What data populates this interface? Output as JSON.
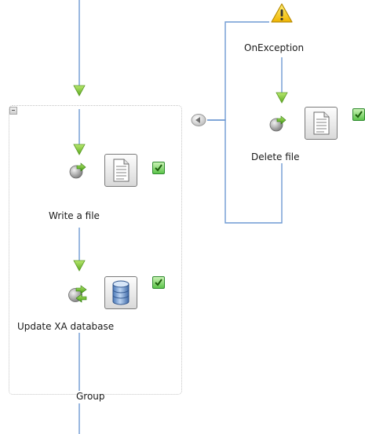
{
  "nodes": {
    "on_exception": "OnException",
    "delete_file": "Delete file",
    "write_file": "Write a file",
    "update_db": "Update XA database",
    "group": "Group"
  },
  "colors": {
    "wire": "#6f9ad3",
    "arrow_head": "#8ccc3c",
    "check": "#5cc44a",
    "warning": "#f5c400"
  },
  "icons": {
    "exception": "warning-icon",
    "file": "document-icon",
    "database": "database-icon",
    "operation": "outbound-arrow-icon",
    "status": "checkmark-icon",
    "collapse": "collapse-icon",
    "connector": "left-arrow-connector-icon"
  }
}
